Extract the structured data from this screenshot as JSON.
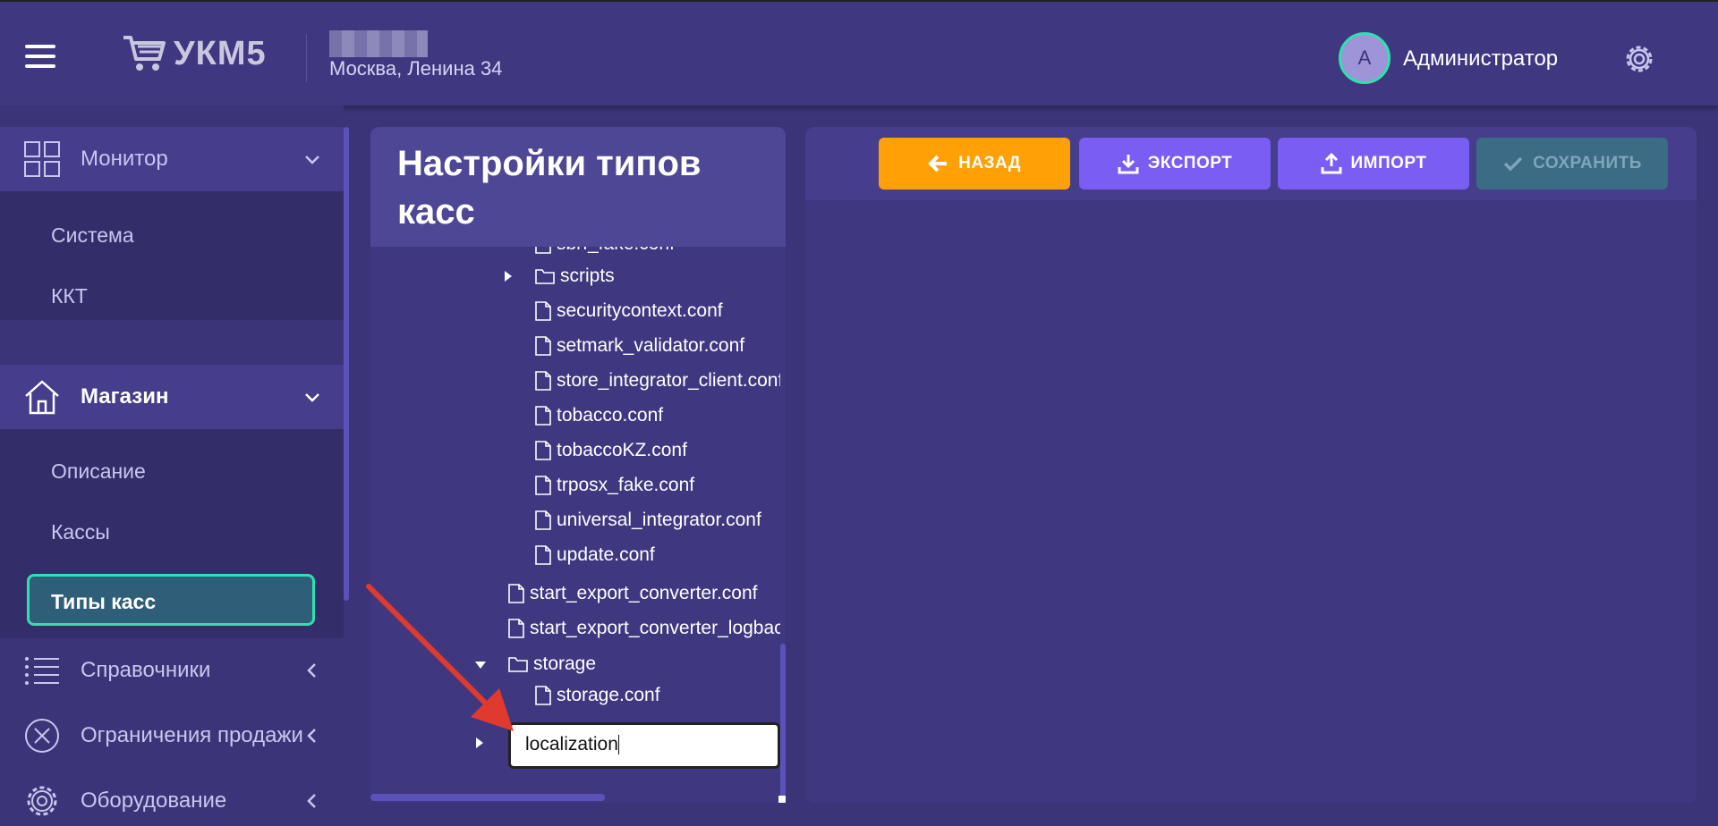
{
  "header": {
    "logo_text": "УКМ5",
    "store_address": "Москва, Ленина 34",
    "user_initial": "A",
    "user_name": "Администратор"
  },
  "sidebar": {
    "monitor": {
      "label": "Монитор",
      "items": [
        "Система",
        "ККТ"
      ]
    },
    "store": {
      "label": "Магазин",
      "items": [
        "Описание",
        "Кассы",
        "Типы касс"
      ],
      "selected": "Типы касс"
    },
    "directories": "Справочники",
    "sale_limits": "Ограничения продажи",
    "equipment": "Оборудование"
  },
  "tree": {
    "title": "Настройки типов касс",
    "rows": {
      "r0": "sbrf_fake.conf",
      "r1": "scripts",
      "r2": "securitycontext.conf",
      "r3": "setmark_validator.conf",
      "r4": "store_integrator_client.conf",
      "r5": "tobacco.conf",
      "r6": "tobaccoKZ.conf",
      "r7": "trposx_fake.conf",
      "r8": "universal_integrator.conf",
      "r9": "update.conf",
      "r10": "start_export_converter.conf",
      "r11": "start_export_converter_logback.xml",
      "r12": "storage",
      "r13": "storage.conf"
    },
    "edit_value": "localization"
  },
  "toolbar": {
    "back": "НАЗАД",
    "export": "ЭКСПОРТ",
    "import": "ИМПОРТ",
    "save": "СОХРАНИТЬ"
  },
  "colors": {
    "background": "#3c3478",
    "accent_teal": "#2fe0b0",
    "back_button": "#ffa106",
    "action_button": "#7a5df2",
    "save_disabled": "#3b6b85",
    "arrow": "#e03a2e"
  }
}
